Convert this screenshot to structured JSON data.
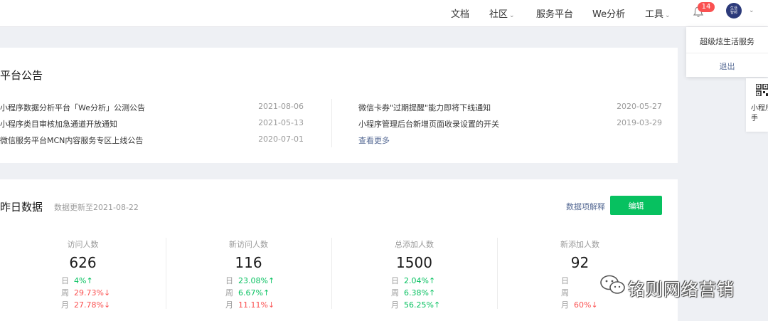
{
  "nav": {
    "items": [
      {
        "label": "文档",
        "has_caret": false
      },
      {
        "label": "社区",
        "has_caret": true
      },
      {
        "label": "服务平台",
        "has_caret": false
      },
      {
        "label": "We分析",
        "has_caret": false
      },
      {
        "label": "工具",
        "has_caret": true
      }
    ],
    "notification_count": "14",
    "avatar_text": "生活 智邦"
  },
  "account_menu": {
    "account_name": "超级炫生活服务",
    "logout": "退出"
  },
  "assistant": {
    "text": "小程序助手"
  },
  "notices": {
    "title": "平台公告",
    "left": [
      {
        "text": "小程序数据分析平台「We分析」公测公告",
        "date": "2021-08-06"
      },
      {
        "text": "小程序类目审核加急通道开放通知",
        "date": "2021-05-13"
      },
      {
        "text": "微信服务平台MCN内容服务专区上线公告",
        "date": "2020-07-01"
      }
    ],
    "right": [
      {
        "text": "微信卡券\"过期提醒\"能力即将下线通知",
        "date": "2020-05-27"
      },
      {
        "text": "小程序管理后台新增页面收录设置的开关",
        "date": "2019-03-29"
      }
    ],
    "more": "查看更多"
  },
  "yesterday": {
    "title": "昨日数据",
    "updated": "数据更新至2021-08-22",
    "explain": "数据项解释",
    "edit": "编辑",
    "metrics": [
      {
        "label": "访问人数",
        "value": "626",
        "trends": [
          {
            "p": "日",
            "v": "4%↑",
            "dir": "up"
          },
          {
            "p": "周",
            "v": "29.73%↓",
            "dir": "down"
          },
          {
            "p": "月",
            "v": "27.78%↓",
            "dir": "down"
          }
        ]
      },
      {
        "label": "新访问人数",
        "value": "116",
        "trends": [
          {
            "p": "日",
            "v": "23.08%↑",
            "dir": "up"
          },
          {
            "p": "周",
            "v": "6.67%↑",
            "dir": "up"
          },
          {
            "p": "月",
            "v": "11.11%↓",
            "dir": "down"
          }
        ]
      },
      {
        "label": "总添加人数",
        "value": "1500",
        "trends": [
          {
            "p": "日",
            "v": "2.04%↑",
            "dir": "up"
          },
          {
            "p": "周",
            "v": "6.38%↑",
            "dir": "up"
          },
          {
            "p": "月",
            "v": "56.25%↑",
            "dir": "up"
          }
        ]
      },
      {
        "label": "新添加人数",
        "value": "92",
        "trends": [
          {
            "p": "日",
            "v": "",
            "dir": "up"
          },
          {
            "p": "周",
            "v": "",
            "dir": "up"
          },
          {
            "p": "月",
            "v": "60%↓",
            "dir": "down"
          }
        ]
      }
    ]
  },
  "watermark": {
    "text": "铭则网络营销"
  },
  "colors": {
    "accent_green": "#07c160",
    "link_blue": "#576b95",
    "down_red": "#fa5151",
    "page_bg": "#eef0f4"
  }
}
